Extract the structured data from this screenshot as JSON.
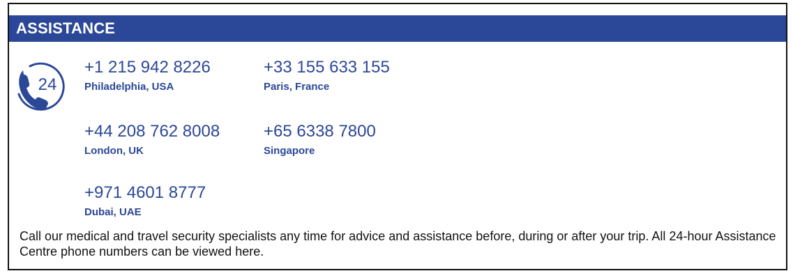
{
  "header": {
    "title": "ASSISTANCE"
  },
  "icon": {
    "name": "phone-24-icon",
    "label": "24"
  },
  "contacts": [
    {
      "number": "+1 215 942 8226",
      "city": "Philadelphia, USA"
    },
    {
      "number": "+33 155 633 155",
      "city": "Paris, France"
    },
    {
      "number": "+44 208 762 8008",
      "city": "London, UK"
    },
    {
      "number": "+65 6338 7800",
      "city": "Singapore"
    },
    {
      "number": "+971 4601 8777",
      "city": "Dubai, UAE"
    }
  ],
  "description": "Call our medical and travel security specialists any time for advice and assistance before, during or after your trip. All 24-hour Assistance Centre phone numbers can be viewed here.",
  "colors": {
    "brand": "#2b4797",
    "text": "#111111",
    "header_text": "#ffffff"
  }
}
